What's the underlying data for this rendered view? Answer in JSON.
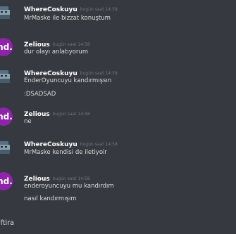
{
  "messages": [
    {
      "author": "WhereCoskuyu",
      "time": "bugün saat 14:58",
      "lines": [
        "MrMaske ile bizzat konuştum"
      ]
    },
    {
      "author": "Zelious",
      "time": "bugün saat 14:58",
      "avatar_text": "ınd.",
      "lines": [
        "dur olayı anlatıyorum"
      ]
    },
    {
      "author": "WhereCoskuyu",
      "time": "bugün saat 14:58",
      "lines": [
        "EnderOyuncuyu kandırmışsın",
        ":DSADSAD"
      ]
    },
    {
      "author": "Zelious",
      "time": "bugün saat 14:58",
      "avatar_text": "ınd.",
      "lines": [
        "ne"
      ]
    },
    {
      "author": "WhereCoskuyu",
      "time": "bugün saat 14:58",
      "lines": [
        "MrMaske kendisi de iletiyoir"
      ]
    },
    {
      "author": "Zelious",
      "time": "bugün saat 14:58",
      "avatar_text": "ınd.",
      "lines": [
        "enderoyuncuyu mu kandırdım",
        "nasıl kandırmışım"
      ]
    }
  ],
  "input": {
    "value": "iftira"
  },
  "colors": {
    "background": "#36393f",
    "username": "#ffffff",
    "timestamp": "#72767d",
    "text": "#dcddde",
    "zelious_avatar": "#8e24aa"
  },
  "icons": {
    "wherecoskuyu_avatar": "pixel-art-avatar-icon",
    "zelious_avatar": "ind-text-avatar-icon"
  }
}
